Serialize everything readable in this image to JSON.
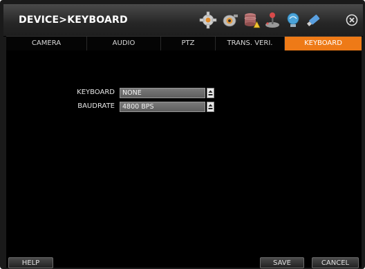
{
  "window": {
    "title": "DEVICE>KEYBOARD"
  },
  "toolbar_icons": [
    "gear-icon",
    "camera-icon",
    "database-icon",
    "joystick-icon",
    "network-icon",
    "usb-icon",
    "close-icon"
  ],
  "tabs": [
    {
      "label": "CAMERA"
    },
    {
      "label": "AUDIO"
    },
    {
      "label": "PTZ"
    },
    {
      "label": "TRANS. VERI."
    },
    {
      "label": "KEYBOARD",
      "active": true
    }
  ],
  "form": {
    "keyboard": {
      "label": "KEYBOARD",
      "value": "NONE"
    },
    "baudrate": {
      "label": "BAUDRATE",
      "value": "4800 BPS"
    }
  },
  "footer": {
    "help_label": "HELP",
    "save_label": "SAVE",
    "cancel_label": "CANCEL"
  },
  "colors": {
    "accent": "#ee7a17",
    "background": "#000000",
    "field": "#6a6a6a"
  }
}
